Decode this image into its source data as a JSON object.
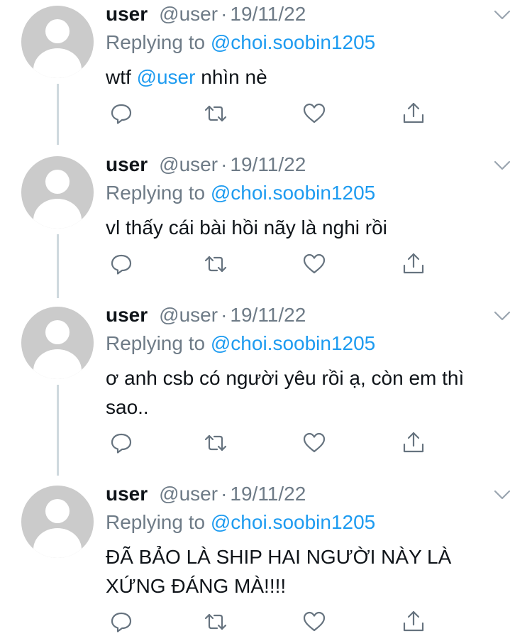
{
  "replying_prefix": "Replying to",
  "colors": {
    "link": "#1d9bf0",
    "secondary_text": "#6e7b87",
    "primary_text": "#0f1419",
    "avatar_placeholder": "#cbcbcb",
    "thread_line": "#cfd9de"
  },
  "icons": {
    "reply": "reply-icon",
    "retweet": "retweet-icon",
    "like": "heart-icon",
    "share": "share-icon",
    "menu": "chevron-down-icon",
    "avatar": "default-avatar-icon"
  },
  "tweets": [
    {
      "name": "user",
      "handle": "@user",
      "separator": "·",
      "date": "19/11/22",
      "replying_to": "@choi.soobin1205",
      "text_pre": "wtf ",
      "text_mention": "@user",
      "text_post": " nhìn nè",
      "text_line2": ""
    },
    {
      "name": "user",
      "handle": "@user",
      "separator": "·",
      "date": "19/11/22",
      "replying_to": "@choi.soobin1205",
      "text": "vl thấy cái bài hồi nãy là nghi rồi"
    },
    {
      "name": "user",
      "handle": "@user",
      "separator": "·",
      "date": "19/11/22",
      "replying_to": "@choi.soobin1205",
      "text_line1": "ơ anh csb có người yêu rồi ạ, còn em thì",
      "text_line2": "sao.."
    },
    {
      "name": "user",
      "handle": "@user",
      "separator": "·",
      "date": "19/11/22",
      "replying_to": "@choi.soobin1205",
      "text_line1": "ĐÃ BẢO LÀ SHIP HAI NGƯỜI NÀY LÀ",
      "text_line2": "XỨNG ĐÁNG MÀ!!!!"
    }
  ]
}
